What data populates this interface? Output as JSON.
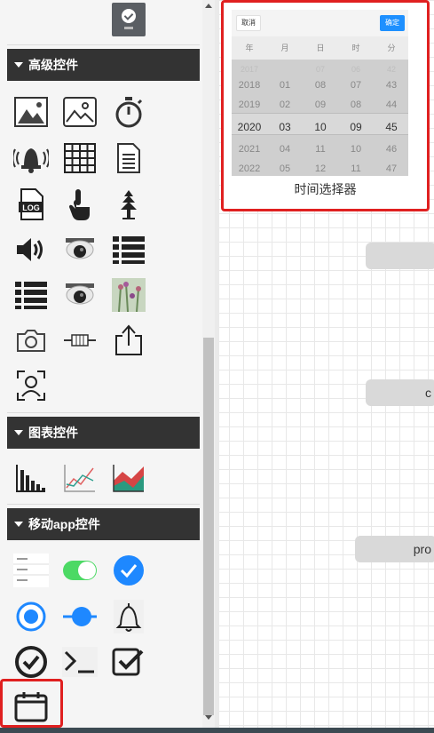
{
  "sections": [
    {
      "title": "高级控件"
    },
    {
      "title": "图表控件"
    },
    {
      "title": "移动app控件"
    }
  ],
  "advanced_icons": [
    "image-icon",
    "landscape-icon",
    "stopwatch-icon",
    "alarm-bell-icon",
    "grid-icon",
    "document-icon",
    "log-file-icon",
    "tap-hand-icon",
    "tree-icon",
    "speaker-icon",
    "security-camera-icon",
    "list-icon",
    "list-icon-2",
    "dome-camera-icon",
    "flower-photo-icon",
    "camera-icon",
    "resistor-icon",
    "share-icon",
    "face-scan-icon"
  ],
  "chart_icons": [
    "bar-chart-icon",
    "line-chart-icon",
    "area-chart-icon"
  ],
  "mobile_icons": [
    "list-text-icon",
    "toggle-switch-icon",
    "checkbox-circle-icon",
    "radio-button-icon",
    "slider-icon",
    "bell-icon",
    "check-circle-icon",
    "terminal-icon",
    "checkbox-square-icon",
    "calendar-icon"
  ],
  "preview": {
    "caption": "时间选择器",
    "cancel_label": "取消",
    "ok_label": "确定",
    "headers": [
      "年",
      "月",
      "日",
      "时",
      "分"
    ],
    "columns": [
      [
        "2017",
        "2018",
        "2019",
        "2020",
        "2021",
        "2022"
      ],
      [
        "",
        "01",
        "02",
        "03",
        "04",
        "05"
      ],
      [
        "07",
        "08",
        "09",
        "10",
        "11",
        "12"
      ],
      [
        "06",
        "07",
        "08",
        "09",
        "10",
        "11"
      ],
      [
        "42",
        "43",
        "44",
        "45",
        "46",
        "47"
      ]
    ]
  },
  "canvas_nodes": [
    "",
    "c",
    "pro"
  ],
  "colors": {
    "highlight": "#e02020",
    "header_bg": "#333333",
    "accent_blue": "#1e90ff",
    "toggle_green": "#4cd964"
  }
}
